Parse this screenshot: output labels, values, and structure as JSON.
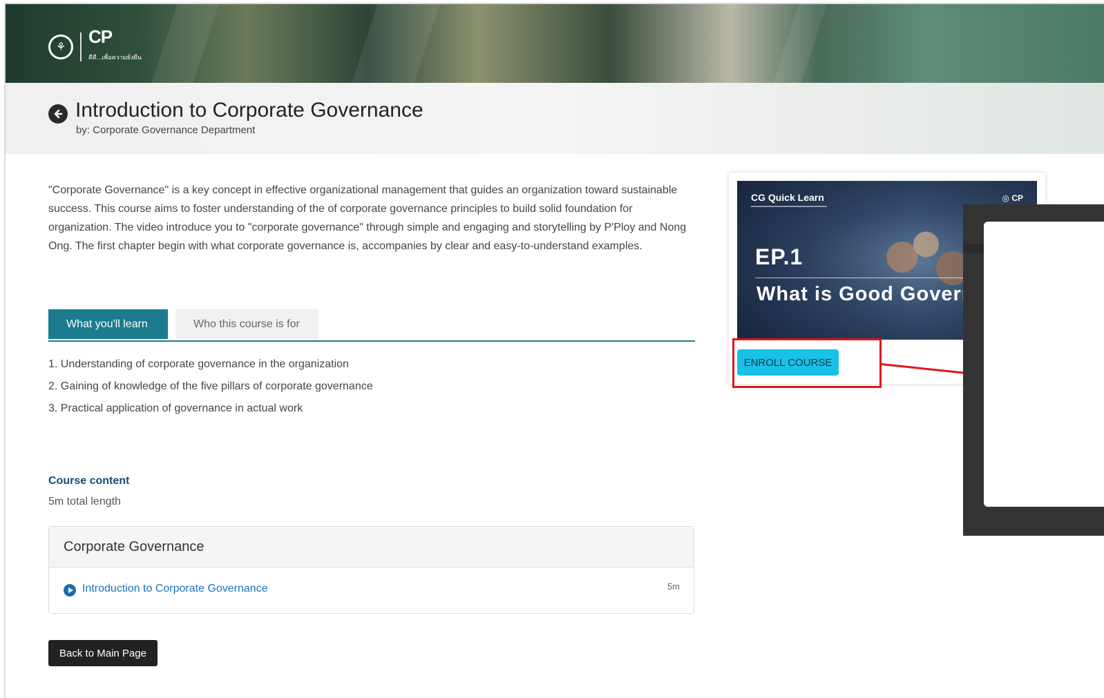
{
  "course": {
    "title": "Introduction to Corporate Governance",
    "byline": "by: Corporate Governance Department",
    "description": "\"Corporate Governance\" is a key concept in effective organizational management that guides an organization toward sustainable success. This course aims to foster understanding of the of corporate governance principles to build solid foundation for organization. The video introduce you to \"corporate governance\" through simple and engaging and storytelling by P'Ploy and Nong Ong. The first chapter begin with what corporate governance is, accompanies by clear and easy-to-understand examples."
  },
  "branding": {
    "logo_text": "CP",
    "logo_subtext": "ดีดี...เพื่อความยั่งยืน"
  },
  "tabs": [
    {
      "label": "What you'll learn",
      "active": true
    },
    {
      "label": "Who this course is for",
      "active": false
    }
  ],
  "learn_items": [
    "1. Understanding of corporate governance in the organization",
    "2. Gaining of knowledge of the five pillars of corporate governance",
    "3. Practical application of governance in actual work"
  ],
  "content": {
    "heading": "Course content",
    "total_length": "5m total length",
    "section_title": "Corporate Governance",
    "lesson_title": "Introduction to Corporate Governance",
    "lesson_duration": "5m"
  },
  "buttons": {
    "back_main": "Back to Main Page",
    "enroll": "ENROLL COURSE"
  },
  "thumbnail": {
    "series": "CG Quick Learn",
    "logos": "CP",
    "episode": "EP.1",
    "headline": "What is Good Governance"
  },
  "colors": {
    "accent_teal": "#1a7c8e",
    "enroll_cyan": "#19c1e6",
    "highlight_red": "#e0141d",
    "link_blue": "#1a73c2"
  }
}
